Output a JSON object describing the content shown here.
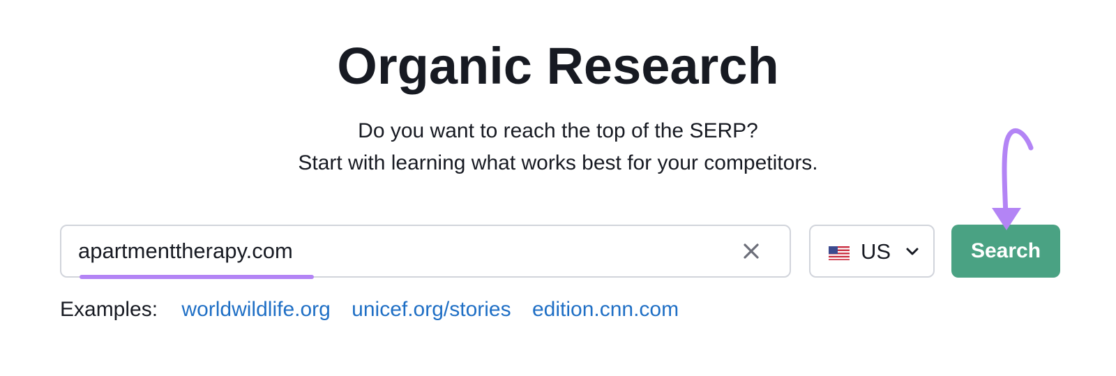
{
  "header": {
    "title": "Organic Research",
    "subtitle_line1": "Do you want to reach the top of the SERP?",
    "subtitle_line2": "Start with learning what works best for your competitors."
  },
  "search": {
    "value": "apartmenttherapy.com",
    "clear_icon": "close-icon"
  },
  "country": {
    "flag_icon": "us-flag-icon",
    "label": "US",
    "chevron_icon": "chevron-down-icon"
  },
  "search_button": {
    "label": "Search",
    "color": "#4aa283"
  },
  "examples": {
    "label": "Examples:",
    "links": [
      "worldwildlife.org",
      "unicef.org/stories",
      "edition.cnn.com"
    ]
  },
  "colors": {
    "accent_annotation": "#b384f5",
    "link": "#1f6fc5",
    "text": "#171a22"
  }
}
